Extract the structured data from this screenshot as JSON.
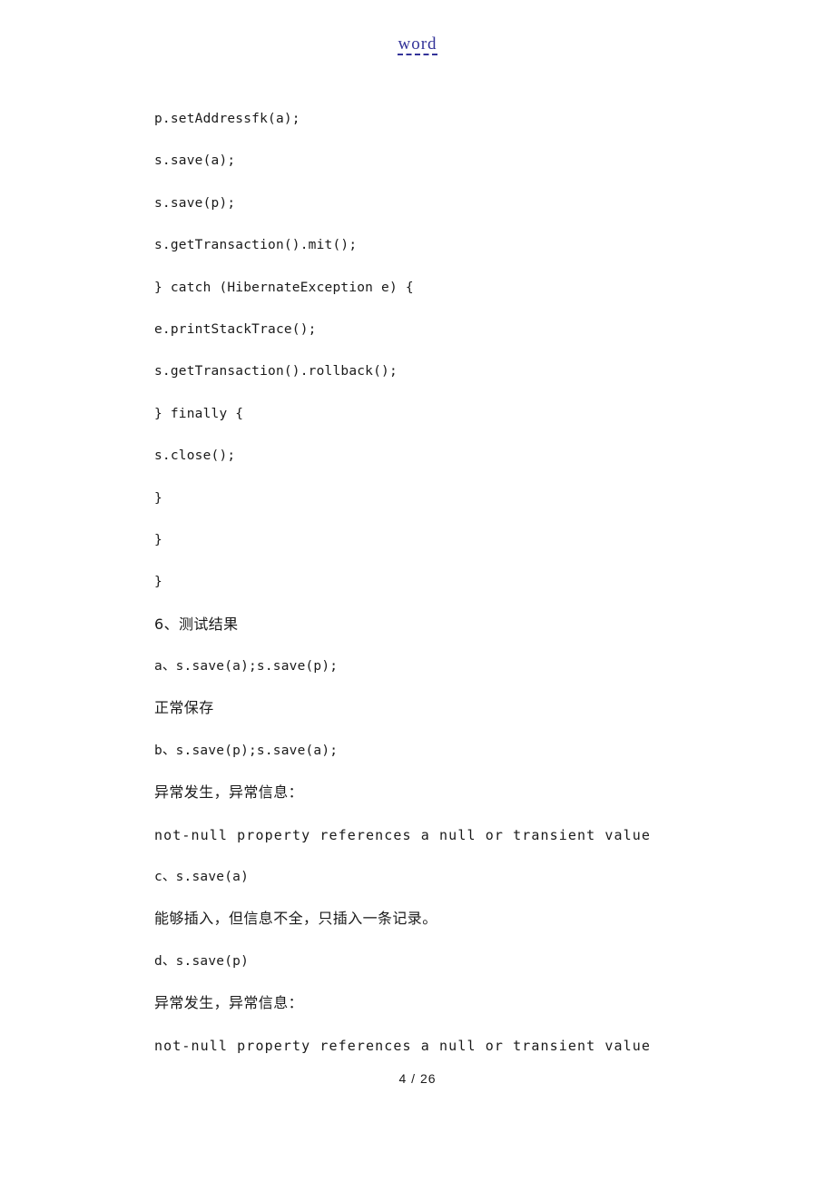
{
  "header": {
    "watermark": "word"
  },
  "document": {
    "lines": [
      {
        "text": "p.setAddressfk(a);",
        "style": "code"
      },
      {
        "text": "s.save(a);",
        "style": "code"
      },
      {
        "text": "s.save(p);",
        "style": "code"
      },
      {
        "text": "s.getTransaction().mit();",
        "style": "code"
      },
      {
        "text": "} catch (HibernateException e) {",
        "style": "code"
      },
      {
        "text": "e.printStackTrace();",
        "style": "code"
      },
      {
        "text": "s.getTransaction().rollback();",
        "style": "code"
      },
      {
        "text": "} finally {",
        "style": "code"
      },
      {
        "text": "s.close();",
        "style": "code"
      },
      {
        "text": "}",
        "style": "code"
      },
      {
        "text": "}",
        "style": "code"
      },
      {
        "text": "}",
        "style": "code"
      },
      {
        "text": "6、测试结果",
        "style": "cjk"
      },
      {
        "text": "a、s.save(a);s.save(p);",
        "style": "code"
      },
      {
        "text": "正常保存",
        "style": "cjk"
      },
      {
        "text": "b、s.save(p);s.save(a);",
        "style": "code"
      },
      {
        "text": "异常发生，异常信息：",
        "style": "cjk"
      },
      {
        "text": "not-null property references a null or transient value",
        "style": "code-wide"
      },
      {
        "text": "c、s.save(a)",
        "style": "code"
      },
      {
        "text": "能够插入，但信息不全，只插入一条记录。",
        "style": "cjk"
      },
      {
        "text": "d、s.save(p)",
        "style": "code"
      },
      {
        "text": "异常发生，异常信息：",
        "style": "cjk"
      },
      {
        "text": "not-null property references a null or transient value",
        "style": "code-wide"
      }
    ]
  },
  "footer": {
    "page_number": "4 / 26"
  }
}
